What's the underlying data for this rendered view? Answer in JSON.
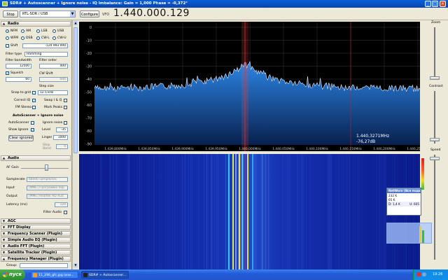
{
  "window": {
    "title": "SDR# + Autoscanner + Ignore noise - IQ Imbalance: Gain = 1,000 Phase = -0,372°"
  },
  "toolbar": {
    "stop_label": "Stop",
    "source": "RTL-SDR / USB",
    "configure_label": "Configure",
    "vfo_label": "VFO",
    "frequency": "1.440.000.129"
  },
  "sidebar": {
    "radio": {
      "header": "Radio",
      "modes": [
        {
          "label": "NFM",
          "selected": true
        },
        {
          "label": "AM",
          "selected": false
        },
        {
          "label": "LSB",
          "selected": false
        },
        {
          "label": "USB",
          "selected": false
        },
        {
          "label": "WFM",
          "selected": false
        },
        {
          "label": "DSB",
          "selected": false
        },
        {
          "label": "CW-L",
          "selected": false
        },
        {
          "label": "CW-U",
          "selected": false
        }
      ],
      "shift_label": "Shift",
      "shift_value": "-124 993 000",
      "filter_type_label": "Filter type",
      "filter_type_value": "Hamming",
      "filter_bandwidth_label": "Filter bandwidth",
      "filter_bandwidth_value": "12500",
      "filter_order_label": "Filter order",
      "filter_order_value": "400",
      "squelch_label": "Squelch",
      "squelch_value": "60",
      "cw_shift_label": "CW Shift",
      "cw_shift_value": "600",
      "step_size_label": "Step size",
      "snap_to_grid_label": "Snap to grid",
      "step_size_value": "12.5 kHz",
      "correct_iq_label": "Correct IQ",
      "swap_iq_label": "Swap I & Q",
      "fm_stereo_label": "FM Stereo",
      "mark_peaks_label": "Mark Peaks"
    },
    "autoscanner": {
      "header": "AutoScanner + Ignore noise",
      "autoscanner_label": "AutoScanner",
      "ignore_noise_label": "Ignore noise",
      "show_ignore_label": "Show Ignore",
      "level_label": "Level",
      "level_value": "-35",
      "clear_ignored_label": "Clear ignored",
      "linger_label": "Linger",
      "linger_value": "1000",
      "step_band_label": "Step Band",
      "step_band_value": "4"
    },
    "audio": {
      "header": "Audio",
      "af_gain_label": "AF Gain",
      "samplerate_label": "Samplerate",
      "samplerate_value": "48000 sample/sec",
      "input_label": "Input",
      "input_value": "[MME] Программа пер",
      "output_label": "Output",
      "output_value": "[MME] Realtek HD Aud",
      "latency_label": "Latency (ms)",
      "latency_value": "120",
      "filter_audio_label": "Filter Audio"
    },
    "plugins": [
      "AGC",
      "FFT Display",
      "Frequency Scanner (Plugin)",
      "Simple Audio EQ (Plugin)",
      "Audio FFT (Plugin)",
      "Satellite Tracker (Plugin)",
      "Frequency Manager (Plugin)"
    ],
    "group_label": "Group:"
  },
  "spectrum": {
    "y_ticks": [
      "0",
      "-10",
      "-20",
      "-30",
      "-40",
      "-50",
      "-60",
      "-70",
      "-80",
      "-90"
    ],
    "x_ticks": [
      "1.439,800MHz",
      "1.439,850MHz",
      "1.439,900MHz",
      "1.439,950MHz",
      "1.440,000MHz",
      "1.440,050MHz",
      "1.440,100MHz",
      "1.440,150MHz",
      "1.440,200MHz",
      "1.440,250MHz"
    ],
    "cursor_freq": "1.440,3271MHz",
    "cursor_level": "-76,27dB"
  },
  "right_panel": {
    "zoom_label": "Zoom",
    "contrast_label": "Contrast",
    "speed_label": "Speed"
  },
  "networx": {
    "title": "NetWorx (Все подключения)",
    "upload": "232 K",
    "download": "65 K",
    "d_value": "D: 1,4 K",
    "u_value": "U: 605"
  },
  "taskbar": {
    "start_label": "пуск",
    "tasks": [
      "11_290_gfc.jpg (изо...",
      "SDR# + Autoscanner..."
    ],
    "clock": "19:26"
  },
  "colors": {
    "titlebar": "#0842b0",
    "spectrum_fill": "#1a64c8",
    "waterfall_bg": "#000018",
    "carrier": "#ffee44"
  }
}
